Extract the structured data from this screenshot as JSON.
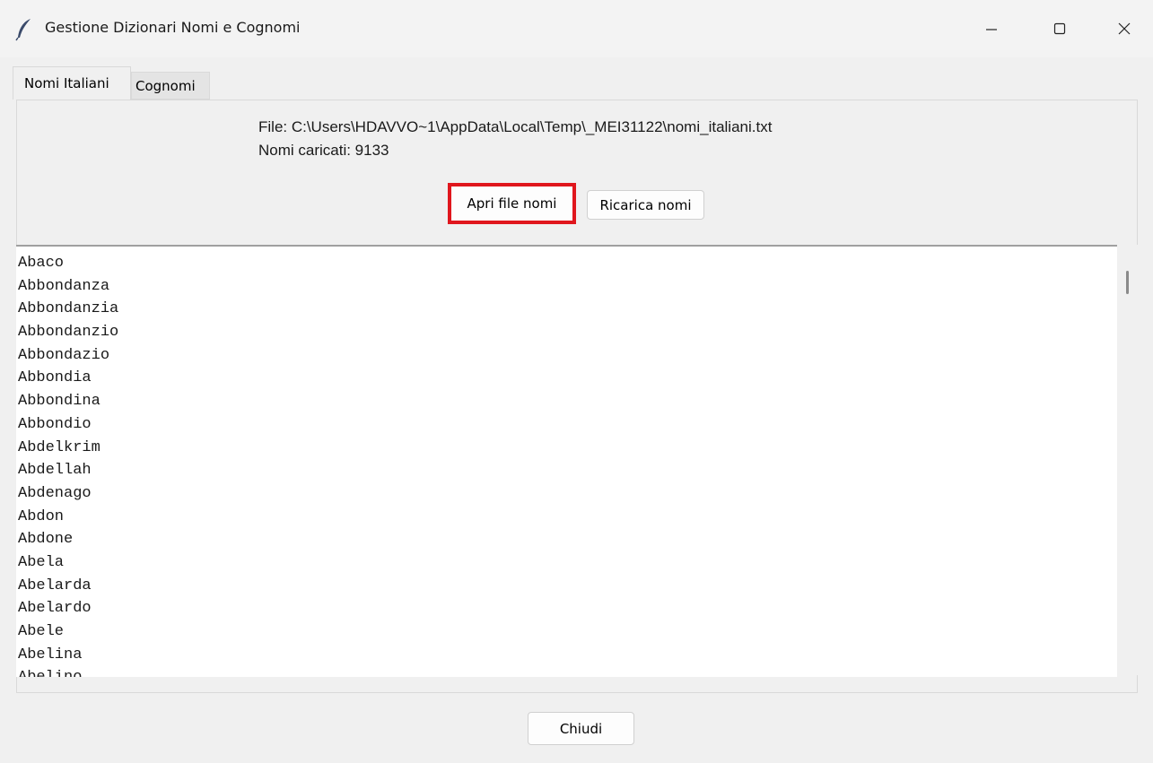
{
  "window": {
    "title": "Gestione Dizionari Nomi e Cognomi",
    "icon": "feather-icon",
    "controls": [
      "minimize-icon",
      "maximize-icon",
      "close-icon"
    ]
  },
  "tabs": [
    {
      "label": "Nomi Italiani",
      "active": true
    },
    {
      "label": "Cognomi",
      "active": false
    }
  ],
  "info": {
    "file": "File: C:\\Users\\HDAVVO~1\\AppData\\Local\\Temp\\_MEI31122\\nomi_italiani.txt",
    "count": "Nomi caricati: 9133"
  },
  "buttons": {
    "open": "Apri file nomi",
    "reload": "Ricarica nomi",
    "close": "Chiudi"
  },
  "highlight_color": "#e0161d",
  "names": [
    "Abaco",
    "Abbondanza",
    "Abbondanzia",
    "Abbondanzio",
    "Abbondazio",
    "Abbondia",
    "Abbondina",
    "Abbondio",
    "Abdelkrim",
    "Abdellah",
    "Abdenago",
    "Abdon",
    "Abdone",
    "Abela",
    "Abelarda",
    "Abelardo",
    "Abele",
    "Abelina",
    "Abelino"
  ]
}
